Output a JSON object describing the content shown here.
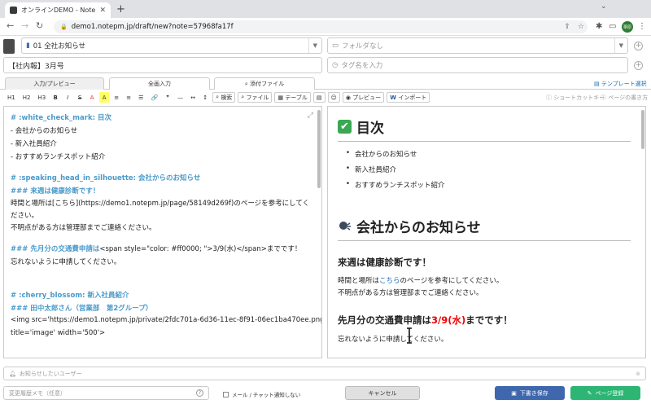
{
  "browser": {
    "tab_title": "オンラインDEMO - NotePM",
    "url": "demo1.notepm.jp/draft/new?note=57968fa17f",
    "profile_initials": "栗原"
  },
  "editor_header": {
    "folder_select": "01 全社お知らせ",
    "folder2_placeholder": "フォルダなし",
    "title_value": "【社内報】3月号",
    "tag_placeholder": "タグ名を入力"
  },
  "mode_tabs": [
    "入力/プレビュー",
    "全画入力",
    "添付ファイル"
  ],
  "template_link": "テンプレート選択",
  "toolbar": {
    "buttons": [
      "H1",
      "H2",
      "H3",
      "B",
      "I",
      "S",
      "A",
      "A",
      "≡",
      "≡",
      "☰",
      "🔗",
      "❞",
      "—",
      "↔",
      "↕"
    ],
    "search": "検索",
    "file": "ファイル",
    "table": "テーブル",
    "preview": "プレビュー",
    "import": "インポート",
    "shortcut": "ショートカットキー",
    "howto": "ページの書き方"
  },
  "markdown": [
    {
      "cls": "h",
      "text": "# :white_check_mark: 目次"
    },
    {
      "cls": "t",
      "text": "- 会社からのお知らせ"
    },
    {
      "cls": "t",
      "text": "- 新入社員紹介"
    },
    {
      "cls": "t",
      "text": "- おすすめランチスポット紹介"
    },
    {
      "cls": "h",
      "text": "# :speaking_head_in_silhouette: 会社からのお知らせ"
    },
    {
      "cls": "h",
      "text": "### 来週は健康診断です！"
    },
    {
      "cls": "t",
      "text": "時間と場所は[こちら](https://demo1.notepm.jp/page/58149d269f)のページを参考にしてく"
    },
    {
      "cls": "t",
      "text": "ださい。"
    },
    {
      "cls": "t",
      "text": "不明点がある方は管理部までご連絡ください。"
    },
    {
      "cls": "h",
      "text": "### 先月分の交通費申請は"
    },
    {
      "cls": "t",
      "text": "<span style=\"color: #ff0000; \">3/9(水)</span>までです！"
    },
    {
      "cls": "t",
      "text": "忘れないように申請してください。"
    },
    {
      "cls": "h",
      "text": "# :cherry_blossom: 新入社員紹介"
    },
    {
      "cls": "h",
      "text": "### 田中太郎さん（営業部　第2グループ）"
    },
    {
      "cls": "t",
      "text": "<img src='https://demo1.notepm.jp/private/2fdc701a-6d36-11ec-8f91-06ec1ba470ee.png'"
    },
    {
      "cls": "t",
      "text": "title='image' width='500'>"
    }
  ],
  "preview": {
    "toc_title": "目次",
    "toc_items": [
      "会社からのお知らせ",
      "新入社員紹介",
      "おすすめランチスポット紹介"
    ],
    "section_title": "会社からのお知らせ",
    "h3_health": "来週は健康診断です！",
    "p1_before": "時間と場所は",
    "p1_link": "こちら",
    "p1_after": "のページを参考にしてください。",
    "p2": "不明点がある方は管理部までご連絡ください。",
    "h3_fare_before": "先月分の交通費申請は",
    "h3_fare_red": "3/9(水)",
    "h3_fare_after": "までです！",
    "p3": "忘れないように申請してください。"
  },
  "bottom": {
    "notify_placeholder": "お知らせしたいユーザー",
    "memo_placeholder": "変更履歴メモ（任意）",
    "mail_label": "メール / チャット通知しない",
    "cancel": "キャンセル",
    "draft": "下書き保存",
    "publish": "ページ登録"
  }
}
